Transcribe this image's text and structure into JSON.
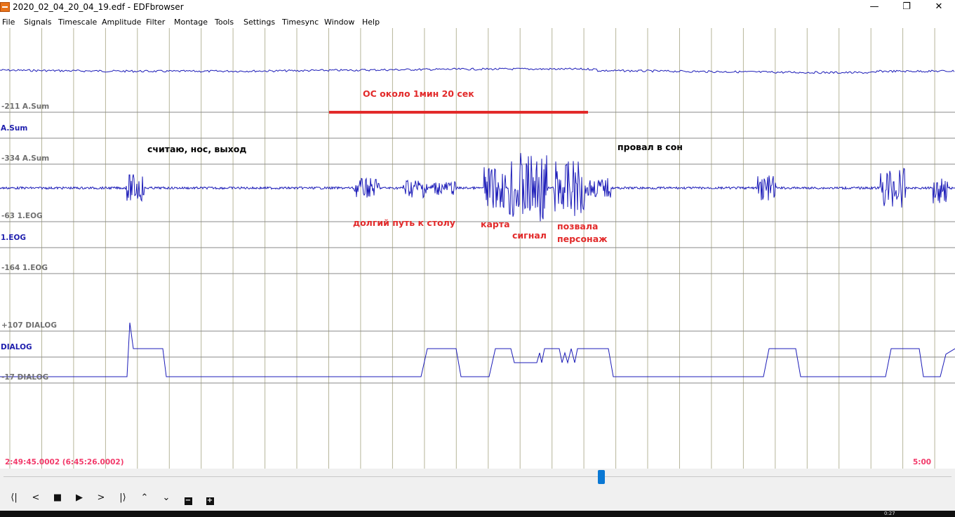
{
  "window": {
    "title": "2020_02_04_20_04_19.edf - EDFbrowser",
    "controls": [
      "—",
      "❐",
      "✕"
    ]
  },
  "menu": [
    "File",
    "Signals",
    "Timescale",
    "Amplitude",
    "Filter",
    "Montage",
    "Tools",
    "Settings",
    "Timesync",
    "Window",
    "Help"
  ],
  "signals": {
    "asum": {
      "label": "A.Sum",
      "upper": "-211 A.Sum",
      "lower": "-334 A.Sum"
    },
    "eog": {
      "label": "1.EOG",
      "upper": "-63 1.EOG",
      "lower": "-164 1.EOG"
    },
    "dialog": {
      "label": "DIALOG",
      "upper": "+107 DIALOG",
      "lower": "-17 DIALOG"
    }
  },
  "annotations": {
    "os": "ОС около 1мин 20 сек",
    "counting": "считаю, нос, выход",
    "sleep": "провал в сон",
    "path": "долгий путь к столу",
    "map": "карта",
    "signal": "сигнал",
    "called_1": "позвала",
    "called_2": "персонаж"
  },
  "time": {
    "start": "2:49:45.0002 (6:45:26.0002)",
    "span": "5:00"
  },
  "toolbar": {
    "first": "⟨|",
    "prev": "<",
    "stop": "■",
    "play": "▶",
    "next": ">",
    "last": "|⟩",
    "up": "⌃",
    "down": "⌄",
    "minus": "−",
    "plus": "+"
  },
  "taskbar": {
    "clock": "0:27"
  },
  "colors": {
    "trace": "#1c1cb8",
    "grid": "#b6b59a",
    "annotation": "#e22a2a",
    "time": "#f23b6b",
    "scroll_handle": "#0a78d4"
  }
}
